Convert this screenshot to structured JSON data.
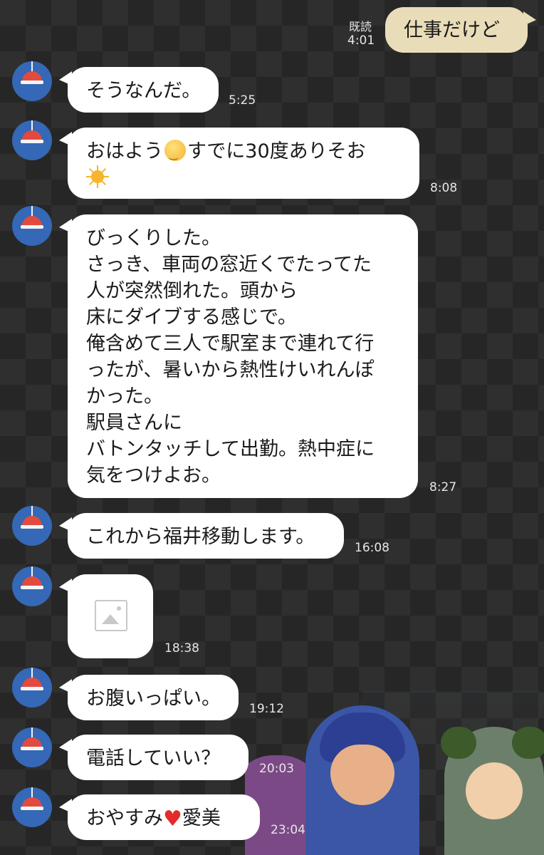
{
  "sent": {
    "text": "仕事だけど",
    "read_label": "既読",
    "time": "4:01",
    "bubble_color": "#e9dcb8"
  },
  "messages": [
    {
      "lines": [
        "そうなんだ。"
      ],
      "time": "5:25"
    },
    {
      "lines": [
        "おはよう",
        "すでに30度ありそお"
      ],
      "time": "8:08",
      "emoji": [
        "sun-with-face-emoji",
        "sun-emoji"
      ]
    },
    {
      "lines": [
        "びっくりした。",
        "さっき、車両の窓近くでたってた",
        "人が突然倒れた。頭から",
        "床にダイブする感じで。",
        "俺含めて三人で駅室まで連れて行",
        "ったが、暑いから熱性けいれんぽ",
        "かった。",
        "駅員さんに",
        "バトンタッチして出勤。熱中症に",
        "気をつけよお。"
      ],
      "time": "8:27"
    },
    {
      "lines": [
        "これから福井移動します。"
      ],
      "time": "16:08"
    },
    {
      "lines": [],
      "time": "18:38",
      "image": "image-placeholder-icon"
    },
    {
      "lines": [
        "お腹いっぱい。"
      ],
      "time": "19:12"
    },
    {
      "lines": [
        "電話していい？"
      ],
      "time": "20:03"
    },
    {
      "lines": [
        "おやすみ",
        "愛美"
      ],
      "time": "23:04",
      "emoji": [
        "red-heart-emoji"
      ]
    }
  ],
  "theme": {
    "background": "#2f2f2f",
    "pattern": "#262626",
    "avatar_color": "#3568b6",
    "lamp_color": "#e34a3f"
  }
}
